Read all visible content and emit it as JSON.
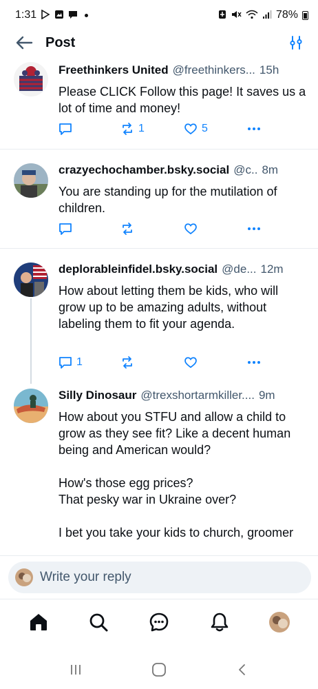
{
  "status_bar": {
    "time": "1:31",
    "battery": "78%"
  },
  "header": {
    "title": "Post"
  },
  "posts": [
    {
      "author": "Freethinkers United",
      "handle": "@freethinkers...",
      "time": "15h",
      "text": "Please CLICK Follow this page!  It saves us a lot of time and money!",
      "reply_count": "",
      "repost_count": "1",
      "like_count": "5"
    },
    {
      "author": "crazyechochamber.bsky.social",
      "handle": "@c..",
      "time": "8m",
      "text": "You are standing up for the mutilation of children.",
      "reply_count": "",
      "repost_count": "",
      "like_count": ""
    },
    {
      "author": "deplorableinfidel.bsky.social",
      "handle": "@de...",
      "time": "12m",
      "text": "How about letting them be kids, who will grow up to be amazing adults, without labeling them to fit your agenda.",
      "reply_count": "1",
      "repost_count": "",
      "like_count": ""
    },
    {
      "author": "Silly Dinosaur",
      "handle": "@trexshortarmkiller....",
      "time": "9m",
      "text": "How about you STFU and allow a child to grow as they see fit? Like a decent human being and American would?\n\nHow's those egg prices?\nThat pesky war in Ukraine over?\n\nI bet you take your kids to church, groomer",
      "reply_count": "",
      "repost_count": "",
      "like_count": ""
    }
  ],
  "reply_bar": {
    "placeholder": "Write your reply"
  },
  "bottom_nav": [
    "home-icon",
    "search-icon",
    "chat-icon",
    "bell-icon",
    "profile-avatar"
  ],
  "colors": {
    "accent": "#1083fe",
    "muted_text": "#42576c",
    "text": "#0b0f14",
    "divider": "#e8ecf0"
  }
}
